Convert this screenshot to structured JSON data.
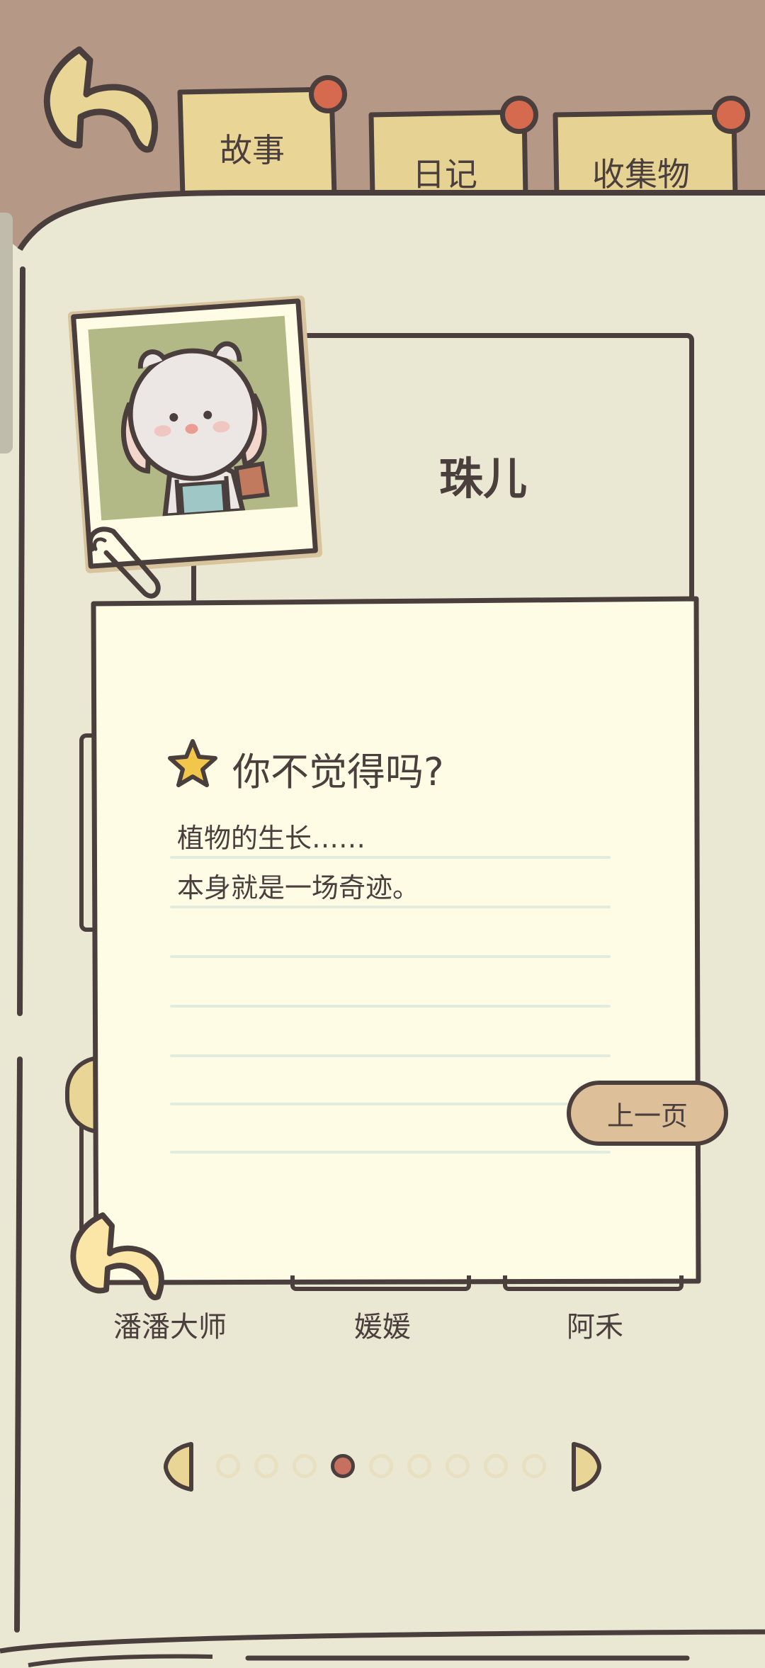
{
  "tabs": {
    "story": "故事",
    "diary": "日记",
    "collection": "收集物"
  },
  "profile": {
    "name": "珠儿"
  },
  "note": {
    "title": "你不觉得吗?",
    "lines": [
      "植物的生长……",
      "本身就是一场奇迹。"
    ],
    "prev_button": "上一页"
  },
  "characters": [
    "潘潘大师",
    "媛媛",
    "阿禾"
  ],
  "pagination": {
    "total": 9,
    "current": 4
  },
  "colors": {
    "background_top": "#b69886",
    "book_page": "#eae7d3",
    "note_paper": "#fffce6",
    "tab": "#e9d696",
    "pin": "#d66a4f",
    "outline": "#4a3f3d",
    "button": "#ddc09a",
    "active_dot": "#c7705f"
  }
}
